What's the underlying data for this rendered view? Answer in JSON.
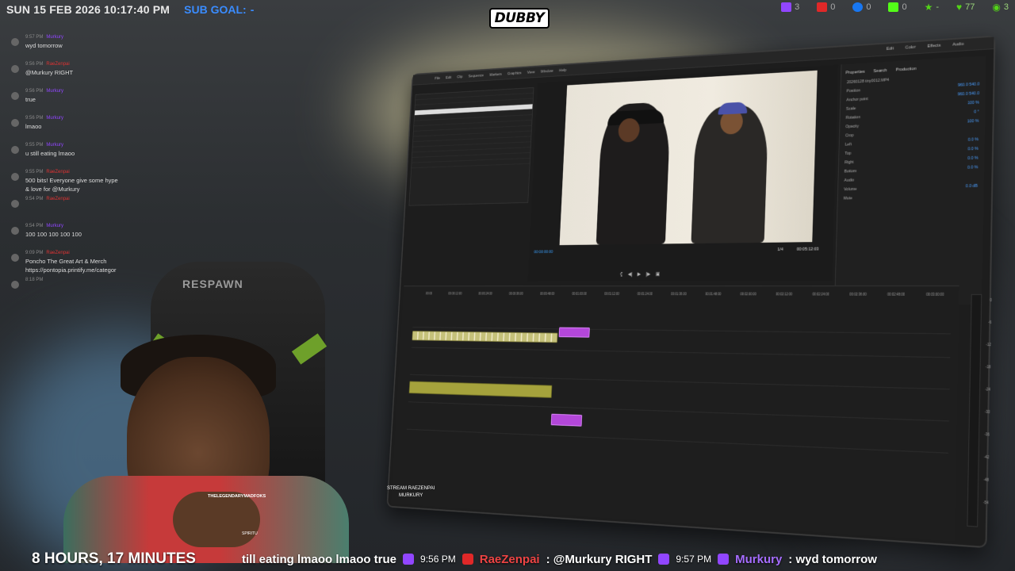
{
  "topbar": {
    "datetime": "SUN 15 FEB 2026 10:17:40 PM",
    "subgoal_label": "SUB GOAL:",
    "subgoal_value": "-",
    "logo": "DUBBY",
    "socials": [
      {
        "icon": "twitch-icon",
        "count": "3"
      },
      {
        "icon": "youtube-icon",
        "count": "0"
      },
      {
        "icon": "facebook-icon",
        "count": "0"
      },
      {
        "icon": "kick-icon",
        "count": "0"
      },
      {
        "icon": "star-icon",
        "count": "-"
      },
      {
        "icon": "heart-icon",
        "count": "77"
      },
      {
        "icon": "viewers-icon",
        "count": "3"
      }
    ]
  },
  "chat": {
    "messages": [
      {
        "time": "9:57 PM",
        "name": "Murkury",
        "text": "wyd tomorrow"
      },
      {
        "time": "9:56 PM",
        "name": "RaeZenpai",
        "text": "@Murkury RIGHT"
      },
      {
        "time": "9:56 PM",
        "name": "Murkury",
        "text": "true"
      },
      {
        "time": "9:56 PM",
        "name": "Murkury",
        "text": "lmaoo"
      },
      {
        "time": "9:55 PM",
        "name": "Murkury",
        "text": "u still eating lmaoo"
      },
      {
        "time": "9:55 PM",
        "name": "RaeZenpai",
        "text": "500 bits! Everyone give some hype & love for @Murkury"
      },
      {
        "time": "9:54 PM",
        "name": "RaeZenpai",
        "text": ""
      },
      {
        "time": "9:54 PM",
        "name": "Murkury",
        "text": "100 100 100 100 100"
      },
      {
        "time": "9:09 PM",
        "name": "RaeZenpai",
        "text": "Poncho The Great Art & Merch https://pontopia.printify.me/categor"
      },
      {
        "time": "8:18 PM",
        "name": "",
        "text": ""
      }
    ]
  },
  "editor": {
    "menu": [
      "File",
      "Edit",
      "Clip",
      "Sequence",
      "Markers",
      "Graphics",
      "View",
      "Window",
      "Help"
    ],
    "workspaces": [
      "Edit",
      "Color",
      "Effects",
      "Audio"
    ],
    "program_timecode": "00:00:00:00",
    "duration": "00:05:12:03",
    "zoom": "1/4",
    "effect_controls": {
      "tabs": [
        "Properties",
        "Search",
        "Production"
      ],
      "clip_name": "20260128 tiny0012.MP4",
      "rows": [
        {
          "label": "Position",
          "value": "960.0  540.0"
        },
        {
          "label": "Anchor point",
          "value": "960.0  540.0"
        },
        {
          "label": "Scale",
          "value": "100 %"
        },
        {
          "label": "Rotation",
          "value": "0 °"
        },
        {
          "label": "Opacity",
          "value": "100 %"
        },
        {
          "label": "Crop",
          "value": ""
        },
        {
          "label": "Left",
          "value": "0.0 %"
        },
        {
          "label": "Top",
          "value": "0.0 %"
        },
        {
          "label": "Right",
          "value": "0.0 %"
        },
        {
          "label": "Bottom",
          "value": "0.0 %"
        },
        {
          "label": "Audio",
          "value": ""
        },
        {
          "label": "Volume",
          "value": "0.0 dB"
        },
        {
          "label": "Mute",
          "value": ""
        }
      ]
    },
    "timeline_ruler": [
      "00:00",
      "00:00:12:00",
      "00:00:24:00",
      "00:00:36:00",
      "00:00:48:00",
      "00:01:00:00",
      "00:01:12:00",
      "00:01:24:00",
      "00:01:36:00",
      "00:01:48:00",
      "00:02:00:00",
      "00:02:12:00",
      "00:02:24:00",
      "00:02:36:00",
      "00:02:48:00",
      "00:03:00:00"
    ],
    "meter_labels": [
      "0",
      "-6",
      "-12",
      "-18",
      "-24",
      "-30",
      "-36",
      "-42",
      "-48",
      "-54"
    ]
  },
  "cam": {
    "chair_brand": "RESPAWN",
    "username_overlay": "THELEGENDARYMADFOKS",
    "small_label": "SPIRITU",
    "stream_label_1": "STREAM RAEZENPAI",
    "stream_label_2": "MURKURY"
  },
  "bottombar": {
    "uptime": "8 HOURS, 17 MINUTES",
    "ticker": [
      {
        "type": "text",
        "value": "till eating lmaoo lmaoo true"
      },
      {
        "type": "badge",
        "color": "purple"
      },
      {
        "type": "time",
        "value": "9:56 PM"
      },
      {
        "type": "badge",
        "color": "red"
      },
      {
        "type": "user",
        "color": "red",
        "value": "RaeZenpai"
      },
      {
        "type": "text",
        "value": ": @Murkury RIGHT"
      },
      {
        "type": "badge",
        "color": "purple"
      },
      {
        "type": "time",
        "value": "9:57 PM"
      },
      {
        "type": "badge",
        "color": "purple"
      },
      {
        "type": "user",
        "color": "purple",
        "value": "Murkury"
      },
      {
        "type": "text",
        "value": ": wyd tomorrow"
      }
    ]
  },
  "colors": {
    "subgoal": "#3a8cff",
    "twitch": "#9146ff",
    "youtube": "#e02828",
    "facebook": "#1877f2",
    "kick": "#53fc18"
  }
}
